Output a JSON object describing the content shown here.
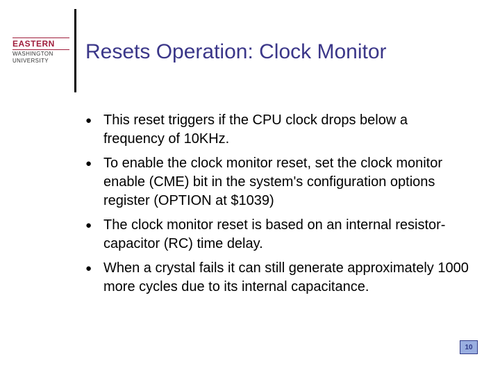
{
  "logo": {
    "line1": "EASTERN",
    "line2": "WASHINGTON",
    "line3": "UNIVERSITY"
  },
  "title": "Resets Operation: Clock Monitor",
  "bullets": [
    "This reset triggers if the CPU clock drops below a frequency of 10KHz.",
    "To enable the clock monitor reset, set the clock monitor enable (CME) bit in the system's configuration options register (OPTION at $1039)",
    "The clock monitor reset is based on an internal resistor-capacitor (RC) time delay.",
    "When a crystal fails it can still generate approximately 1000 more cycles due to its internal capacitance."
  ],
  "page_number": "10"
}
